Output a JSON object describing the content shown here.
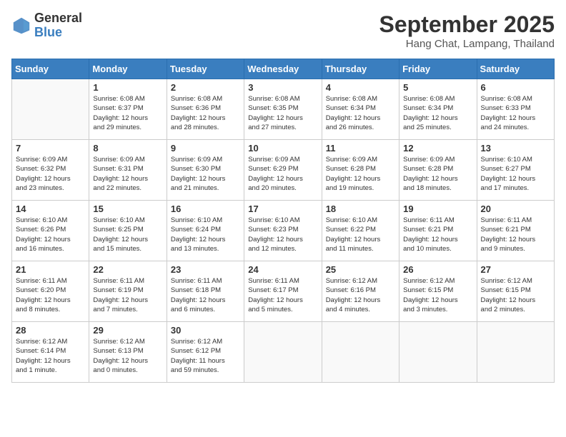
{
  "logo": {
    "general": "General",
    "blue": "Blue"
  },
  "header": {
    "month": "September 2025",
    "location": "Hang Chat, Lampang, Thailand"
  },
  "weekdays": [
    "Sunday",
    "Monday",
    "Tuesday",
    "Wednesday",
    "Thursday",
    "Friday",
    "Saturday"
  ],
  "weeks": [
    [
      {
        "day": "",
        "info": ""
      },
      {
        "day": "1",
        "info": "Sunrise: 6:08 AM\nSunset: 6:37 PM\nDaylight: 12 hours\nand 29 minutes."
      },
      {
        "day": "2",
        "info": "Sunrise: 6:08 AM\nSunset: 6:36 PM\nDaylight: 12 hours\nand 28 minutes."
      },
      {
        "day": "3",
        "info": "Sunrise: 6:08 AM\nSunset: 6:35 PM\nDaylight: 12 hours\nand 27 minutes."
      },
      {
        "day": "4",
        "info": "Sunrise: 6:08 AM\nSunset: 6:34 PM\nDaylight: 12 hours\nand 26 minutes."
      },
      {
        "day": "5",
        "info": "Sunrise: 6:08 AM\nSunset: 6:34 PM\nDaylight: 12 hours\nand 25 minutes."
      },
      {
        "day": "6",
        "info": "Sunrise: 6:08 AM\nSunset: 6:33 PM\nDaylight: 12 hours\nand 24 minutes."
      }
    ],
    [
      {
        "day": "7",
        "info": "Sunrise: 6:09 AM\nSunset: 6:32 PM\nDaylight: 12 hours\nand 23 minutes."
      },
      {
        "day": "8",
        "info": "Sunrise: 6:09 AM\nSunset: 6:31 PM\nDaylight: 12 hours\nand 22 minutes."
      },
      {
        "day": "9",
        "info": "Sunrise: 6:09 AM\nSunset: 6:30 PM\nDaylight: 12 hours\nand 21 minutes."
      },
      {
        "day": "10",
        "info": "Sunrise: 6:09 AM\nSunset: 6:29 PM\nDaylight: 12 hours\nand 20 minutes."
      },
      {
        "day": "11",
        "info": "Sunrise: 6:09 AM\nSunset: 6:28 PM\nDaylight: 12 hours\nand 19 minutes."
      },
      {
        "day": "12",
        "info": "Sunrise: 6:09 AM\nSunset: 6:28 PM\nDaylight: 12 hours\nand 18 minutes."
      },
      {
        "day": "13",
        "info": "Sunrise: 6:10 AM\nSunset: 6:27 PM\nDaylight: 12 hours\nand 17 minutes."
      }
    ],
    [
      {
        "day": "14",
        "info": "Sunrise: 6:10 AM\nSunset: 6:26 PM\nDaylight: 12 hours\nand 16 minutes."
      },
      {
        "day": "15",
        "info": "Sunrise: 6:10 AM\nSunset: 6:25 PM\nDaylight: 12 hours\nand 15 minutes."
      },
      {
        "day": "16",
        "info": "Sunrise: 6:10 AM\nSunset: 6:24 PM\nDaylight: 12 hours\nand 13 minutes."
      },
      {
        "day": "17",
        "info": "Sunrise: 6:10 AM\nSunset: 6:23 PM\nDaylight: 12 hours\nand 12 minutes."
      },
      {
        "day": "18",
        "info": "Sunrise: 6:10 AM\nSunset: 6:22 PM\nDaylight: 12 hours\nand 11 minutes."
      },
      {
        "day": "19",
        "info": "Sunrise: 6:11 AM\nSunset: 6:21 PM\nDaylight: 12 hours\nand 10 minutes."
      },
      {
        "day": "20",
        "info": "Sunrise: 6:11 AM\nSunset: 6:21 PM\nDaylight: 12 hours\nand 9 minutes."
      }
    ],
    [
      {
        "day": "21",
        "info": "Sunrise: 6:11 AM\nSunset: 6:20 PM\nDaylight: 12 hours\nand 8 minutes."
      },
      {
        "day": "22",
        "info": "Sunrise: 6:11 AM\nSunset: 6:19 PM\nDaylight: 12 hours\nand 7 minutes."
      },
      {
        "day": "23",
        "info": "Sunrise: 6:11 AM\nSunset: 6:18 PM\nDaylight: 12 hours\nand 6 minutes."
      },
      {
        "day": "24",
        "info": "Sunrise: 6:11 AM\nSunset: 6:17 PM\nDaylight: 12 hours\nand 5 minutes."
      },
      {
        "day": "25",
        "info": "Sunrise: 6:12 AM\nSunset: 6:16 PM\nDaylight: 12 hours\nand 4 minutes."
      },
      {
        "day": "26",
        "info": "Sunrise: 6:12 AM\nSunset: 6:15 PM\nDaylight: 12 hours\nand 3 minutes."
      },
      {
        "day": "27",
        "info": "Sunrise: 6:12 AM\nSunset: 6:15 PM\nDaylight: 12 hours\nand 2 minutes."
      }
    ],
    [
      {
        "day": "28",
        "info": "Sunrise: 6:12 AM\nSunset: 6:14 PM\nDaylight: 12 hours\nand 1 minute."
      },
      {
        "day": "29",
        "info": "Sunrise: 6:12 AM\nSunset: 6:13 PM\nDaylight: 12 hours\nand 0 minutes."
      },
      {
        "day": "30",
        "info": "Sunrise: 6:12 AM\nSunset: 6:12 PM\nDaylight: 11 hours\nand 59 minutes."
      },
      {
        "day": "",
        "info": ""
      },
      {
        "day": "",
        "info": ""
      },
      {
        "day": "",
        "info": ""
      },
      {
        "day": "",
        "info": ""
      }
    ]
  ]
}
